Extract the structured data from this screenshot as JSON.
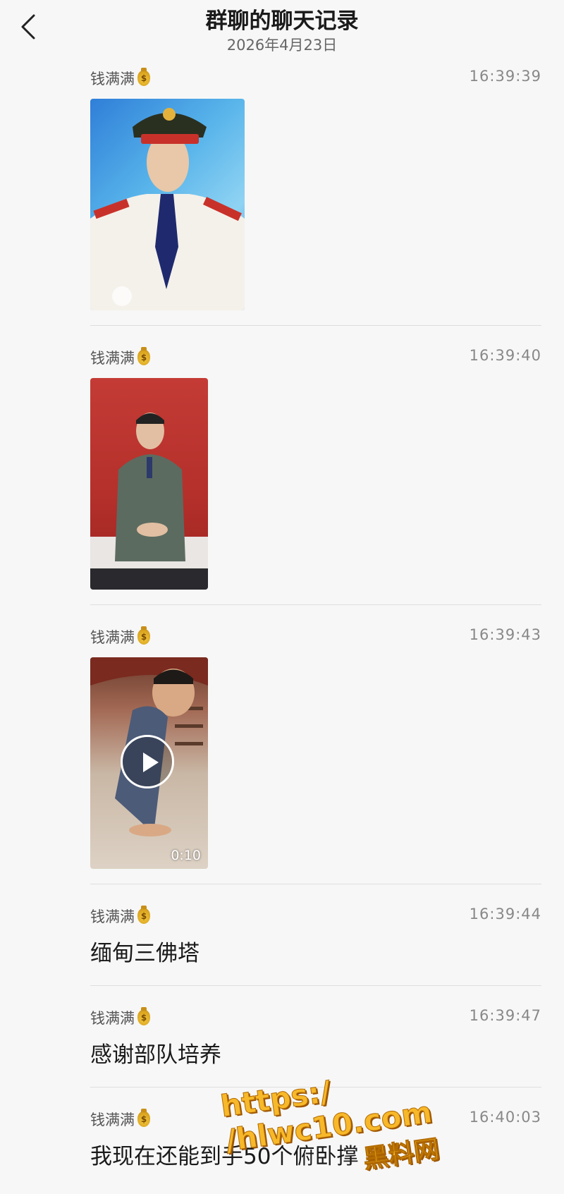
{
  "header": {
    "title": "群聊的聊天记录",
    "date": "2026年4月23日"
  },
  "messages": [
    {
      "sender": "钱满满",
      "time": "16:39:39",
      "type": "image"
    },
    {
      "sender": "钱满满",
      "time": "16:39:40",
      "type": "image"
    },
    {
      "sender": "钱满满",
      "time": "16:39:43",
      "type": "video",
      "duration": "0:10"
    },
    {
      "sender": "钱满满",
      "time": "16:39:44",
      "type": "text",
      "text": "缅甸三佛塔"
    },
    {
      "sender": "钱满满",
      "time": "16:39:47",
      "type": "text",
      "text": "感谢部队培养"
    },
    {
      "sender": "钱满满",
      "time": "16:40:03",
      "type": "text",
      "text": "我现在还能到手50个俯卧撑"
    }
  ],
  "watermark": {
    "url": "https:/ /hlwc10.com",
    "name": "黑料网"
  },
  "colors": {
    "accent": "#f7b82a",
    "divider": "#dedede",
    "background": "#f7f7f7"
  }
}
